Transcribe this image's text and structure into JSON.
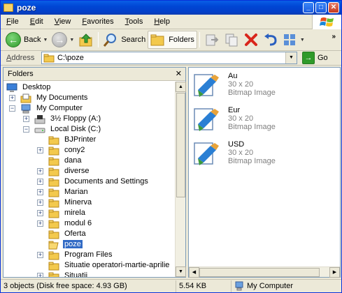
{
  "window": {
    "title": "poze"
  },
  "menu": {
    "items": [
      {
        "underline": "F",
        "rest": "ile"
      },
      {
        "underline": "E",
        "rest": "dit"
      },
      {
        "underline": "V",
        "rest": "iew"
      },
      {
        "underline": "F",
        "rest": "avorites"
      },
      {
        "underline": "T",
        "rest": "ools"
      },
      {
        "underline": "H",
        "rest": "elp"
      }
    ]
  },
  "toolbar": {
    "back_label": "Back",
    "search_label": "Search",
    "folders_label": "Folders",
    "chevron": "»"
  },
  "address": {
    "label_underline": "A",
    "label_rest": "ddress",
    "value": "C:\\poze",
    "go_label": "Go"
  },
  "folders_pane": {
    "header": "Folders",
    "close": "✕",
    "tree": [
      {
        "label": "Desktop",
        "indent": 0,
        "expander": "",
        "icon": "desktop"
      },
      {
        "label": "My Documents",
        "indent": 1,
        "expander": "+",
        "icon": "documents"
      },
      {
        "label": "My Computer",
        "indent": 1,
        "expander": "−",
        "icon": "computer"
      },
      {
        "label": "3½ Floppy (A:)",
        "indent": 2,
        "expander": "+",
        "icon": "floppy"
      },
      {
        "label": "Local Disk (C:)",
        "indent": 2,
        "expander": "−",
        "icon": "disk"
      },
      {
        "label": "BJPrinter",
        "indent": 3,
        "expander": "",
        "icon": "folder"
      },
      {
        "label": "cony2",
        "indent": 3,
        "expander": "+",
        "icon": "folder"
      },
      {
        "label": "dana",
        "indent": 3,
        "expander": "",
        "icon": "folder"
      },
      {
        "label": "diverse",
        "indent": 3,
        "expander": "+",
        "icon": "folder"
      },
      {
        "label": "Documents and Settings",
        "indent": 3,
        "expander": "+",
        "icon": "folder"
      },
      {
        "label": "Marian",
        "indent": 3,
        "expander": "+",
        "icon": "folder"
      },
      {
        "label": "Minerva",
        "indent": 3,
        "expander": "+",
        "icon": "folder"
      },
      {
        "label": "mirela",
        "indent": 3,
        "expander": "+",
        "icon": "folder"
      },
      {
        "label": "modul 6",
        "indent": 3,
        "expander": "+",
        "icon": "folder"
      },
      {
        "label": "Oferta",
        "indent": 3,
        "expander": "",
        "icon": "folder"
      },
      {
        "label": "poze",
        "indent": 3,
        "expander": "",
        "icon": "folder-open",
        "selected": true
      },
      {
        "label": "Program Files",
        "indent": 3,
        "expander": "+",
        "icon": "folder"
      },
      {
        "label": "Situatie operatori-martie-aprilie",
        "indent": 3,
        "expander": "",
        "icon": "folder"
      },
      {
        "label": "Situatii",
        "indent": 3,
        "expander": "+",
        "icon": "folder"
      }
    ]
  },
  "files": [
    {
      "name": "Au",
      "dimensions": "30 x 20",
      "type": "Bitmap Image"
    },
    {
      "name": "Eur",
      "dimensions": "30 x 20",
      "type": "Bitmap Image"
    },
    {
      "name": "USD",
      "dimensions": "30 x 20",
      "type": "Bitmap Image"
    }
  ],
  "status": {
    "objects": "3 objects (Disk free space: 4.93 GB)",
    "size": "5.54 KB",
    "location": "My Computer"
  },
  "colors": {
    "title_bar": "#0046d5",
    "selection": "#316ac5",
    "window_bg": "#ece9d8"
  }
}
